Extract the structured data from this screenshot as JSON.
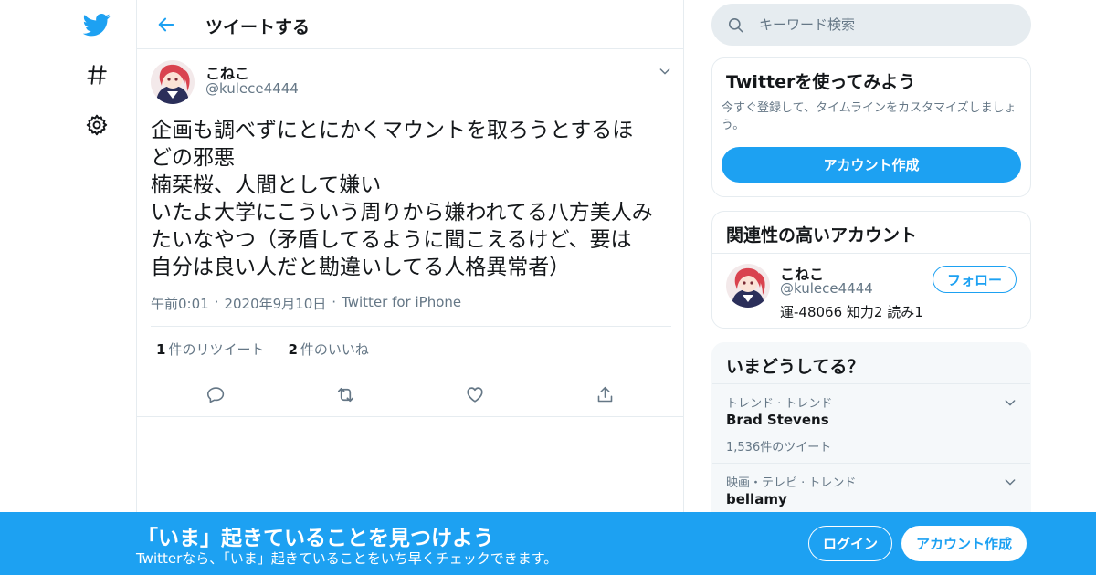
{
  "nav": {
    "icons": [
      "twitter-bird-icon",
      "hashtag-icon",
      "gear-icon"
    ]
  },
  "header": {
    "title": "ツイートする"
  },
  "tweet": {
    "author_name": "こねこ",
    "author_handle": "@kulece4444",
    "text": "企画も調べずにとにかくマウントを取ろうとするほ\nどの邪悪\n楠栞桜、人間として嫌い\nいたよ大学にこういう周りから嫌われてる八方美人み\nたいなやつ（矛盾してるように聞こえるけど、要は\n自分は良い人だと勘違いしてる人格異常者）",
    "time": "午前0:01",
    "date": "2020年9月10日",
    "source": "Twitter for iPhone",
    "separator": "·",
    "retweet_count": "1",
    "retweet_label": "件のリツイート",
    "like_count": "2",
    "like_label": "件のいいね"
  },
  "search": {
    "placeholder": "キーワード検索"
  },
  "signup_card": {
    "title": "Twitterを使ってみよう",
    "description": "今すぐ登録して、タイムラインをカスタマイズしましょう。",
    "button": "アカウント作成"
  },
  "related_card": {
    "title": "関連性の高いアカウント",
    "name": "こねこ",
    "handle": "@kulece4444",
    "bio": "運-48066 知力2 読み1",
    "follow_button": "フォロー"
  },
  "trends_card": {
    "title": "いまどうしてる？",
    "items": [
      {
        "context": "トレンド · トレンド",
        "name": "Brad Stevens",
        "count": "1,536件のツイート"
      },
      {
        "context": "映画・テレビ · トレンド",
        "name": "bellamy",
        "count": ""
      }
    ]
  },
  "bottom_bar": {
    "title": "「いま」起きていることを見つけよう",
    "subtitle": "Twitterなら、「いま」起きていることをいち早くチェックできます。",
    "login_button": "ログイン",
    "signup_button": "アカウント作成"
  },
  "colors": {
    "accent": "#1da1f2",
    "text": "#14171a",
    "muted": "#657786",
    "border": "#e6ecf0"
  }
}
